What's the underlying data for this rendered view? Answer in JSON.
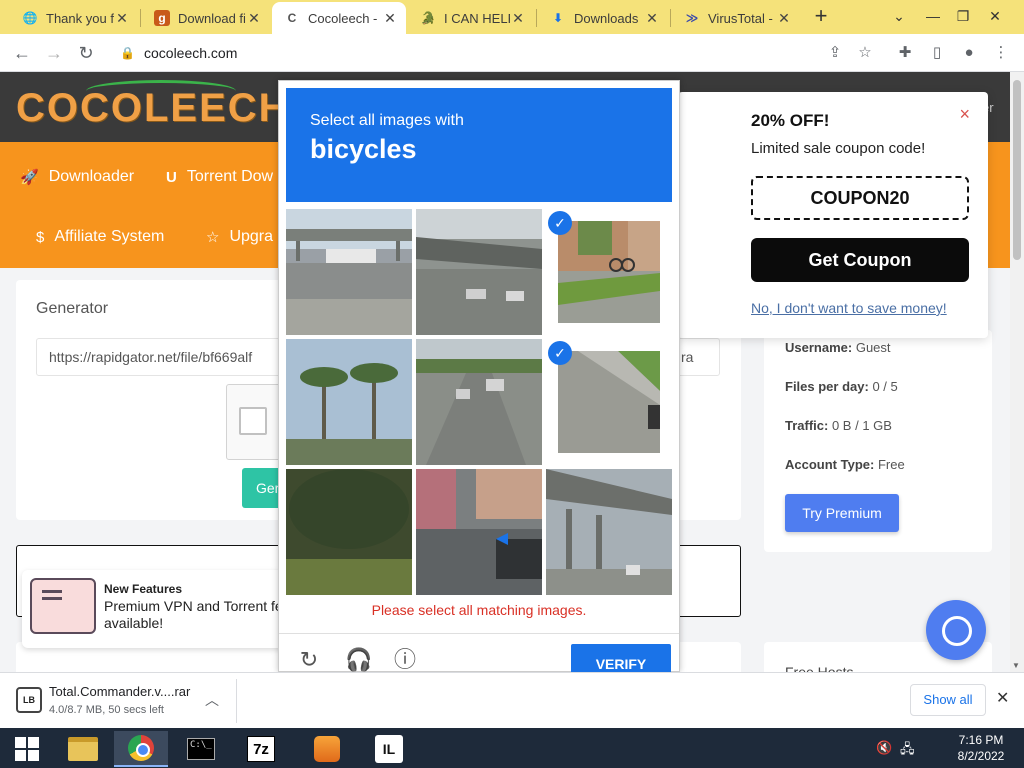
{
  "browser": {
    "tabs": [
      {
        "label": "Thank you fo",
        "icon": "globe-icon",
        "active": false
      },
      {
        "label": "Download fil",
        "icon": "g-logo-icon",
        "active": false
      },
      {
        "label": "Cocoleech - ",
        "icon": "cocoleech-icon",
        "active": true
      },
      {
        "label": "I CAN HELP |",
        "icon": "animal-icon",
        "active": false
      },
      {
        "label": "Downloads",
        "icon": "download-icon",
        "active": false
      },
      {
        "label": "VirusTotal - ",
        "icon": "virustotal-icon",
        "active": false
      }
    ],
    "url": "cocoleech.com"
  },
  "site": {
    "logo": "COCOLEECH",
    "nav": [
      {
        "label": "Downloader",
        "icon": "rocket-icon"
      },
      {
        "label": "Torrent Dow",
        "icon": "magnet-icon"
      },
      {
        "label": "Affiliate System",
        "icon": "dollar-icon"
      },
      {
        "label": "Upgra",
        "icon": "star-icon"
      }
    ],
    "generator": {
      "title": "Generator",
      "input_value": "https://rapidgator.net/file/bf669alf",
      "input_tail": "ra",
      "button_label": "Ger"
    },
    "features": {
      "title": "New Features",
      "text": "Premium VPN and Torrent fe available!"
    },
    "account": {
      "username_label": "Username:",
      "username": "Guest",
      "files_label": "Files per day:",
      "files": "0 / 5",
      "traffic_label": "Traffic:",
      "traffic": "0 B / 1 GB",
      "type_label": "Account Type:",
      "type": "Free",
      "premium_button": "Try Premium"
    },
    "free_hosts": "Free Hosts",
    "header_tail": "er"
  },
  "coupon": {
    "title": "20% OFF!",
    "subtitle": "Limited sale coupon code!",
    "code": "COUPON20",
    "get_button": "Get Coupon",
    "decline_link": "No, I don't want to save money!",
    "close": "×"
  },
  "captcha": {
    "instruction": "Select all images with",
    "target": "bicycles",
    "error": "Please select all matching images.",
    "verify_button": "VERIFY",
    "tiles": [
      {
        "scene": "overpass-bus",
        "selected": false
      },
      {
        "scene": "pedestrian-bridge",
        "selected": false
      },
      {
        "scene": "bicycle-sidewalk",
        "selected": true
      },
      {
        "scene": "palm-trees",
        "selected": false
      },
      {
        "scene": "highway-cars",
        "selected": false
      },
      {
        "scene": "curb-road",
        "selected": true
      },
      {
        "scene": "trees-grass",
        "selected": false
      },
      {
        "scene": "parked-motorcycles",
        "selected": false
      },
      {
        "scene": "elevated-road",
        "selected": false
      }
    ]
  },
  "downloads": {
    "file_name": "Total.Commander.v....rar",
    "status": "4.0/8.7 MB, 50 secs left",
    "show_all": "Show all"
  },
  "taskbar": {
    "apps": [
      "start",
      "file-explorer",
      "chrome",
      "command-prompt",
      "7zip",
      "fl-studio",
      "intellij"
    ],
    "time": "7:16 PM",
    "date": "8/2/2022"
  }
}
